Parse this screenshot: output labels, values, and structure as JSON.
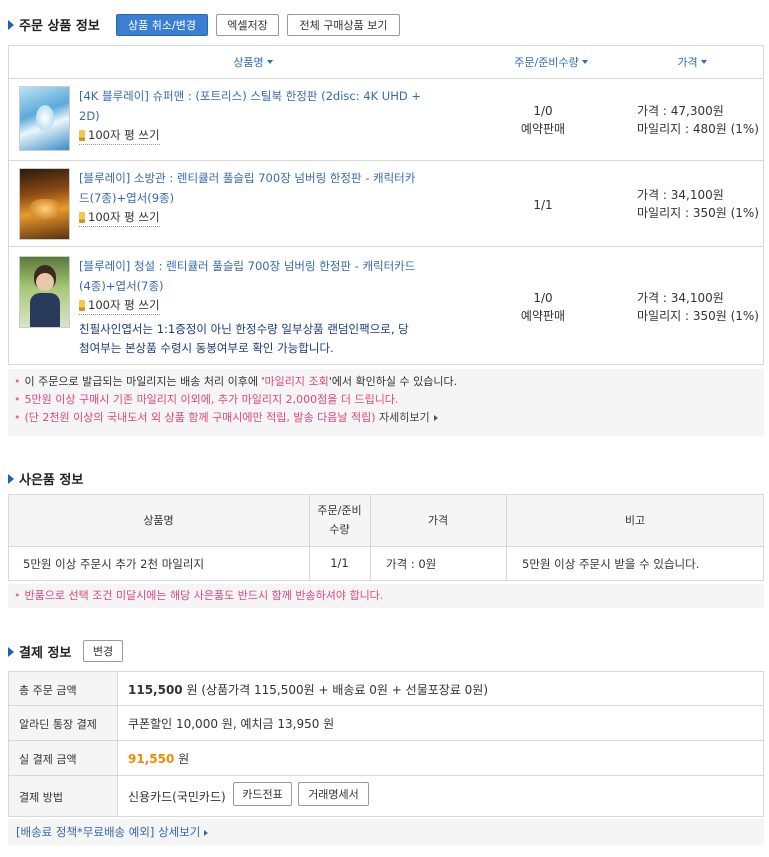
{
  "order": {
    "title": "주문 상품 정보",
    "btn_cancel": "상품 취소/변경",
    "btn_excel": "엑셀저장",
    "btn_all": "전체 구매상품 보기",
    "col_product": "상품명",
    "col_qty": "주문/준비수량",
    "col_price": "가격",
    "items": [
      {
        "name_line1": "[4K 블루레이] 슈퍼맨 : (포트리스) 스틸북 한정판 (2disc: 4K UHD +",
        "name_line2": "2D)",
        "review": "100자 평 쓰기",
        "qty": "1/0",
        "status": "예약판매",
        "price": "가격 : 47,300원",
        "mileage": "마일리지 : 480원 (1%)"
      },
      {
        "name_line1": "[블루레이] 소방관 : 렌티큘러 풀슬립 700장 넘버링 한정판 - 캐릭터카",
        "name_line2": "드(7종)+엽서(9종)",
        "review": "100자 평 쓰기",
        "qty": "1/1",
        "status": "",
        "price": "가격 : 34,100원",
        "mileage": "마일리지 : 350원 (1%)"
      },
      {
        "name_line1": "[블루레이] 청설 : 렌티큘러 풀슬립 700장 넘버링 한정판 - 캐릭터카드",
        "name_line2": "(4종)+엽서(7종)",
        "review": "100자 평 쓰기",
        "notice_line1": "친필사인엽서는 1:1증정이 아닌 한정수량 일부상품 랜덤인팩으로, 당",
        "notice_line2": "첨여부는 본상품 수령시 동봉여부로 확인 가능합니다.",
        "qty": "1/0",
        "status": "예약판매",
        "price": "가격 : 34,100원",
        "mileage": "마일리지 : 350원 (1%)"
      }
    ],
    "note1_a": "이 주문으로 발급되는 마일리지는 배송 처리 이후에 '",
    "note1_link": "마일리지 조회",
    "note1_b": "'에서 확인하실 수 있습니다.",
    "note2": "5만원 이상 구매시 기존 마일리지 이외에, 추가 마일리지 2,000점을 더 드립니다.",
    "note3": "(단 2천원 이상의 국내도서 외 상품 함께 구매시에만 적립, 발송 다음날 적립)",
    "note3_more": "자세히보기"
  },
  "gift": {
    "title": "사은품 정보",
    "col_name": "상품명",
    "col_qty_1": "주문/준비",
    "col_qty_2": "수량",
    "col_price": "가격",
    "col_note": "비고",
    "row_name": "5만원 이상 주문시 추가 2천 마일리지",
    "row_qty": "1/1",
    "row_price": "가격 : 0원",
    "row_note": "5만원 이상 주문시 받을 수 있습니다.",
    "warning": "반품으로 선택 조건 미달시에는 해당 사은품도 반드시 함께 반송하셔야 합니다."
  },
  "payment": {
    "title": "결제 정보",
    "btn_change": "변경",
    "total_label": "총 주문 금액",
    "total_amount": "115,500",
    "total_unit": "원",
    "total_detail": "(상품가격 115,500원 + 배송료 0원 + 선물포장료 0원)",
    "discount_label": "알라딘 통장 결제",
    "discount_value": "쿠폰할인 10,000 원, 예치금 13,950 원",
    "actual_label": "실 결제 금액",
    "actual_amount": "91,550",
    "actual_unit": "원",
    "method_label": "결제 방법",
    "method_value": "신용카드(국민카드)",
    "btn_card": "카드전표",
    "btn_receipt": "거래명세서",
    "shipping_link": "[배송료 정책*무료배송 예외] 상세보기"
  },
  "colors": {
    "accent_blue": "#3a7fd1",
    "link_blue": "#3569b0",
    "pink": "#e0467f",
    "orange": "#f08c00"
  }
}
